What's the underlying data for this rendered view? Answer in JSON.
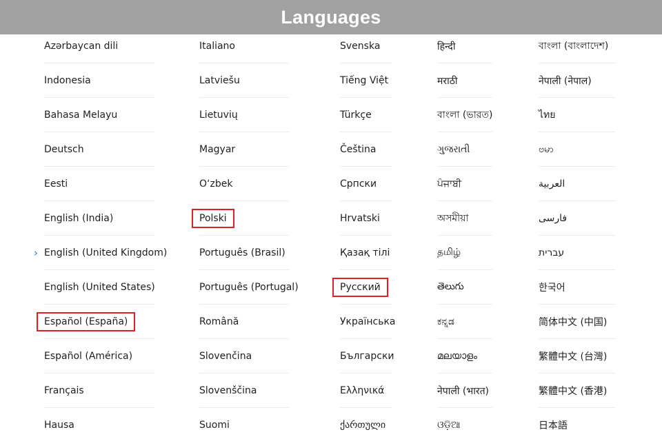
{
  "title": "Languages",
  "columns": [
    {
      "items": [
        {
          "label": "Azərbaycan dili"
        },
        {
          "label": "Indonesia"
        },
        {
          "label": "Bahasa Melayu"
        },
        {
          "label": "Deutsch"
        },
        {
          "label": "Eesti"
        },
        {
          "label": "English (India)"
        },
        {
          "label": "English (United Kingdom)",
          "selected": true
        },
        {
          "label": "English (United States)"
        },
        {
          "label": "Español (España)",
          "highlighted": true
        },
        {
          "label": "Español (América)"
        },
        {
          "label": "Français"
        },
        {
          "label": "Hausa"
        }
      ]
    },
    {
      "items": [
        {
          "label": "Italiano"
        },
        {
          "label": "Latviešu"
        },
        {
          "label": "Lietuvių"
        },
        {
          "label": "Magyar"
        },
        {
          "label": "O‘zbek"
        },
        {
          "label": "Polski",
          "highlighted": true
        },
        {
          "label": "Português (Brasil)"
        },
        {
          "label": "Português (Portugal)"
        },
        {
          "label": "Română"
        },
        {
          "label": "Slovenčina"
        },
        {
          "label": "Slovenščina"
        },
        {
          "label": "Suomi"
        }
      ]
    },
    {
      "items": [
        {
          "label": "Svenska"
        },
        {
          "label": "Tiếng Việt"
        },
        {
          "label": "Türkçe"
        },
        {
          "label": "Čeština"
        },
        {
          "label": "Српски"
        },
        {
          "label": "Hrvatski"
        },
        {
          "label": "Қазақ тілі"
        },
        {
          "label": "Русский",
          "highlighted": true
        },
        {
          "label": "Українська"
        },
        {
          "label": "Български"
        },
        {
          "label": "Ελληνικά"
        },
        {
          "label": "ქართული"
        }
      ]
    },
    {
      "items": [
        {
          "label": "हिन्दी"
        },
        {
          "label": "मराठी"
        },
        {
          "label": "বাংলা (ভারত)"
        },
        {
          "label": "ગુજરાતી"
        },
        {
          "label": "ਪੰਜਾਬੀ"
        },
        {
          "label": "অসমীয়া"
        },
        {
          "label": "தமிழ்"
        },
        {
          "label": "తెలుగు"
        },
        {
          "label": "ಕನ್ನಡ"
        },
        {
          "label": "മലയാളം"
        },
        {
          "label": "नेपाली (भारत)"
        },
        {
          "label": "ଓଡ଼ିଆ"
        }
      ]
    },
    {
      "items": [
        {
          "label": "বাংলা (বাংলাদেশ)"
        },
        {
          "label": "नेपाली (नेपाल)"
        },
        {
          "label": "ไทย"
        },
        {
          "label": "ဗမာ"
        },
        {
          "label": "العربية"
        },
        {
          "label": "فارسی"
        },
        {
          "label": "עברית"
        },
        {
          "label": "한국어"
        },
        {
          "label": "简体中文 (中国)"
        },
        {
          "label": "繁體中文 (台灣)"
        },
        {
          "label": "繁體中文 (香港)"
        },
        {
          "label": "日本語"
        }
      ]
    }
  ],
  "colors": {
    "header_bg": "#a1a1a1",
    "header_text": "#ffffff",
    "highlight_border": "#e02020",
    "selected_chevron": "#2a7fd6",
    "divider": "#ececec"
  },
  "icons": {
    "selected_indicator": "chevron-right-icon"
  }
}
